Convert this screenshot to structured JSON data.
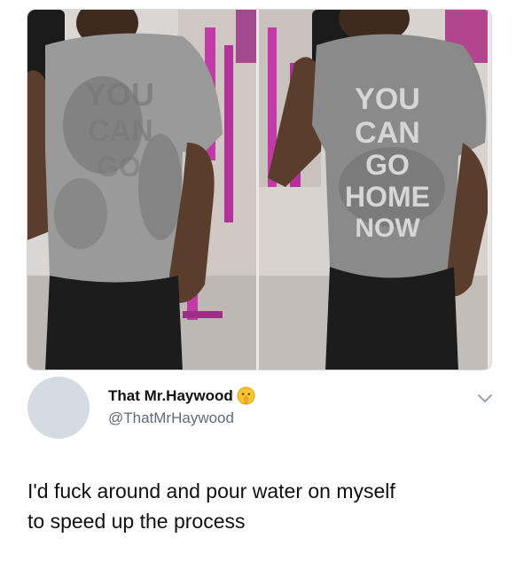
{
  "tweet": {
    "display_name": "That Mr.Haywood",
    "handle": "@ThatMrHaywood",
    "text": "I'd fuck around and pour water on myself\nto speed up the process",
    "badge_emoji": "shushing-face-emoji",
    "menu_icon": "chevron-down-icon"
  },
  "photos": {
    "left": {
      "shirt_text": [
        "YOU",
        "CAN",
        "GO"
      ]
    },
    "right": {
      "shirt_text": [
        "YOU",
        "CAN",
        "GO",
        "HOME",
        "NOW"
      ]
    }
  },
  "colors": {
    "gym_magenta": "#c23aa8",
    "shirt_gray": "#8e8e8e",
    "shirt_wet": "#5f5f5f",
    "skin": "#5a3d2b",
    "shorts": "#1c1c1c",
    "handle_gray": "#5f6b77",
    "avatar": "#d4dbe3"
  }
}
